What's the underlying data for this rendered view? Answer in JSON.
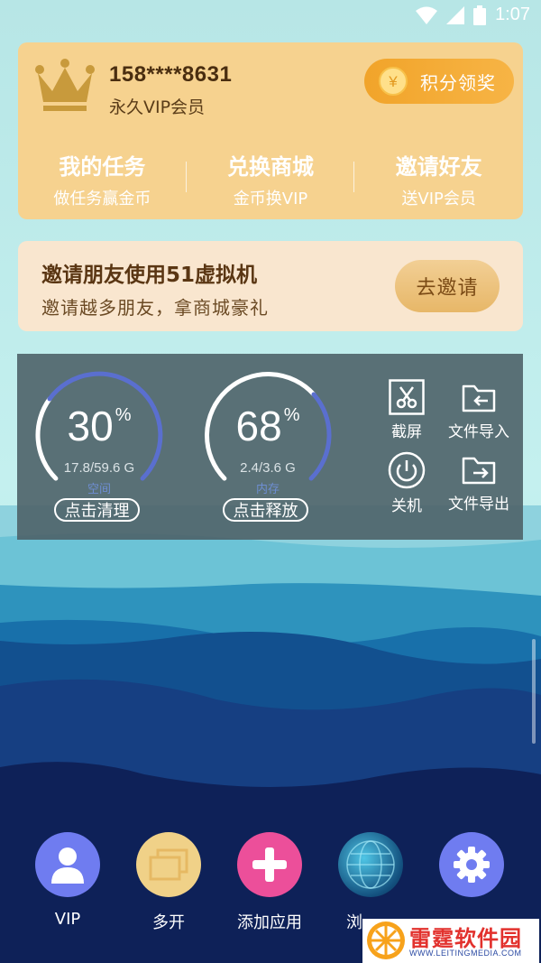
{
  "status_bar": {
    "time": "1:07",
    "icons": [
      "wifi-icon",
      "signal-icon",
      "battery-icon"
    ]
  },
  "vip_card": {
    "phone": "158****8631",
    "member_label": "永久VIP会员",
    "points_button": "积分领奖",
    "coin_symbol": "¥",
    "links": [
      {
        "title": "我的任务",
        "subtitle": "做任务赢金币"
      },
      {
        "title": "兑换商城",
        "subtitle": "金币换VIP"
      },
      {
        "title": "邀请好友",
        "subtitle": "送VIP会员"
      }
    ]
  },
  "invite_card": {
    "title": "邀请朋友使用51虚拟机",
    "subtitle": "邀请越多朋友，拿商城豪礼",
    "button": "去邀请"
  },
  "monitor": {
    "storage": {
      "percent": "30",
      "percent_sign": "%",
      "size": "17.8/59.6 G",
      "label": "空间",
      "action": "点击清理",
      "fraction": 0.3
    },
    "memory": {
      "percent": "68",
      "percent_sign": "%",
      "size": "2.4/3.6 G",
      "label": "内存",
      "action": "点击释放",
      "fraction": 0.68
    },
    "tools": [
      {
        "label": "截屏",
        "icon": "screenshot-scissors-icon"
      },
      {
        "label": "文件导入",
        "icon": "folder-import-icon"
      },
      {
        "label": "关机",
        "icon": "power-icon"
      },
      {
        "label": "文件导出",
        "icon": "folder-export-icon"
      }
    ]
  },
  "dock": [
    {
      "label": "VIP",
      "icon": "user-icon",
      "color": "#6f7cf0"
    },
    {
      "label": "多开",
      "icon": "windows-stack-icon",
      "color": "#f0d188"
    },
    {
      "label": "添加应用",
      "icon": "plus-icon",
      "color": "#ec4f9a"
    },
    {
      "label": "浏",
      "icon": "globe-icon",
      "color": "#1a5f8a"
    },
    {
      "label": "",
      "icon": "gear-icon",
      "color": "#6f7cf0"
    }
  ],
  "watermark": {
    "name": "雷霆软件园",
    "url": "WWW.LEITINGMEDIA.COM"
  },
  "colors": {
    "vip_card": "#f6d28f",
    "points_button": "#f3a52c",
    "gauge_arc": "#5a6fcf",
    "sea_dark": "#0f2253"
  }
}
